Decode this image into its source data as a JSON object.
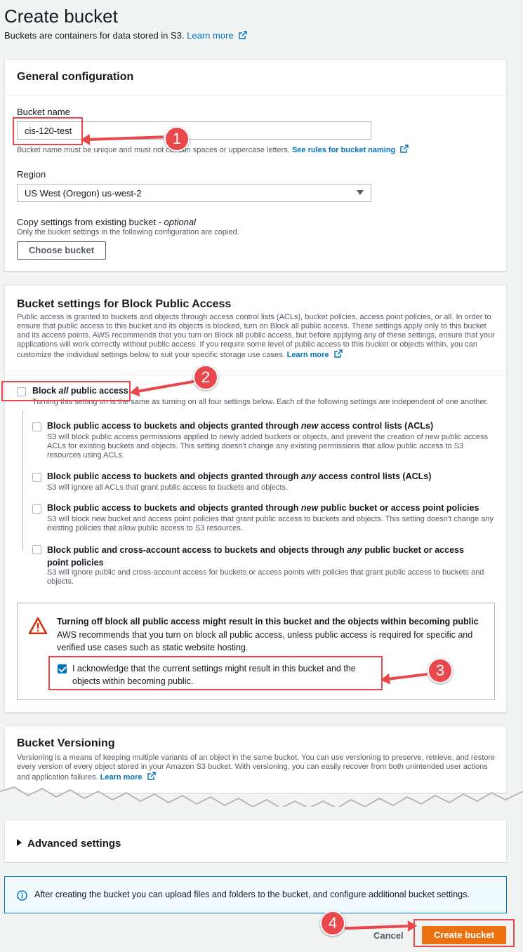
{
  "page": {
    "title": "Create bucket",
    "subtitle": "Buckets are containers for data stored in S3.",
    "learn_more": "Learn more"
  },
  "general": {
    "header": "General configuration",
    "bucket_name_label": "Bucket name",
    "bucket_name_value": "cis-120-test",
    "bucket_name_hint": "Bucket name must be unique and must not contain spaces or uppercase letters.",
    "rules_link": "See rules for bucket naming",
    "region_label": "Region",
    "region_value": "US West (Oregon) us-west-2",
    "copy_label": "Copy settings from existing bucket - ",
    "copy_optional": "optional",
    "copy_desc": "Only the bucket settings in the following configuration are copied.",
    "choose_bucket": "Choose bucket"
  },
  "block_public": {
    "header": "Bucket settings for Block Public Access",
    "desc": "Public access is granted to buckets and objects through access control lists (ACLs), bucket policies, access point policies, or all. In order to ensure that public access to this bucket and its objects is blocked, turn on Block all public access. These settings apply only to this bucket and its access points. AWS recommends that you turn on Block all public access, but before applying any of these settings, ensure that your applications will work correctly without public access. If you require some level of public access to this bucket or objects within, you can customize the individual settings below to suit your specific storage use cases.",
    "learn_more": "Learn more",
    "block_all_pre": "Block ",
    "block_all_em": "all",
    "block_all_post": " public access",
    "block_all_desc": "Turning this setting on is the same as turning on all four settings below. Each of the following settings are independent of one another.",
    "options": [
      {
        "title_pre": "Block public access to buckets and objects granted through ",
        "title_em": "new",
        "title_post": " access control lists (ACLs)",
        "desc": "S3 will block public access permissions applied to newly added buckets or objects, and prevent the creation of new public access ACLs for existing buckets and objects. This setting doesn't change any existing permissions that allow public access to S3 resources using ACLs."
      },
      {
        "title_pre": "Block public access to buckets and objects granted through ",
        "title_em": "any",
        "title_post": " access control lists (ACLs)",
        "desc": "S3 will ignore all ACLs that grant public access to buckets and objects."
      },
      {
        "title_pre": "Block public access to buckets and objects granted through ",
        "title_em": "new",
        "title_post": " public bucket or access point policies",
        "desc": "S3 will block new bucket and access point policies that grant public access to buckets and objects. This setting doesn't change any existing policies that allow public access to S3 resources."
      },
      {
        "title_pre": "Block public and cross-account access to buckets and objects through ",
        "title_em": "any",
        "title_post": " public bucket or access point policies",
        "desc": "S3 will ignore public and cross-account access for buckets or access points with policies that grant public access to buckets and objects."
      }
    ],
    "warning_title": "Turning off block all public access might result in this bucket and the objects within becoming public",
    "warning_desc": "AWS recommends that you turn on block all public access, unless public access is required for specific and verified use cases such as static website hosting.",
    "acknowledge": "I acknowledge that the current settings might result in this bucket and the objects within becoming public."
  },
  "versioning": {
    "header": "Bucket Versioning",
    "desc": "Versioning is a means of keeping multiple variants of an object in the same bucket. You can use versioning to preserve, retrieve, and restore every version of every object stored in your Amazon S3 bucket. With versioning, you can easily recover from both unintended user actions and application failures.",
    "learn_more": "Learn more"
  },
  "advanced": {
    "label": "Advanced settings"
  },
  "info": {
    "text": "After creating the bucket you can upload files and folders to the bucket, and configure additional bucket settings."
  },
  "footer": {
    "cancel": "Cancel",
    "create": "Create bucket"
  },
  "callouts": [
    "1",
    "2",
    "3",
    "4"
  ],
  "colors": {
    "accent": "#0073bb",
    "primary": "#ec7211",
    "annotation": "#e8474c",
    "warning": "#d13212"
  }
}
